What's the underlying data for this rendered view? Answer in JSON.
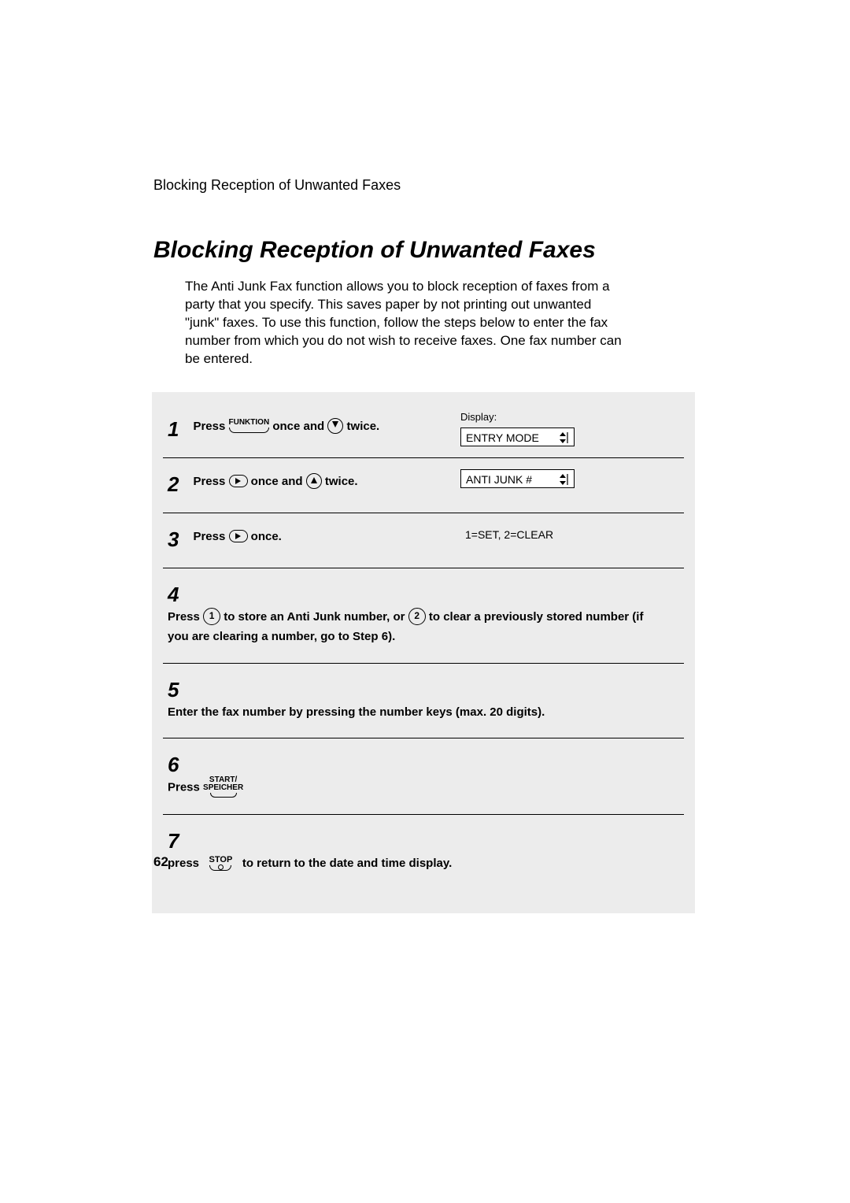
{
  "running_head": "Blocking Reception of Unwanted Faxes",
  "title": "Blocking Reception of Unwanted Faxes",
  "intro": "The Anti Junk Fax function allows you to block reception of faxes from a party that you specify. This saves paper by not printing out unwanted \"junk\" faxes. To use this function, follow the steps below to enter the fax number from which you do not wish to receive faxes. One fax number can be entered.",
  "display_label": "Display:",
  "steps": {
    "s1": {
      "num": "1",
      "t1": "Press ",
      "key1": "FUNKTION",
      "t2": " once and ",
      "t3": " twice.",
      "lcd": "ENTRY MODE"
    },
    "s2": {
      "num": "2",
      "t1": "Press ",
      "t2": " once and ",
      "t3": " twice.",
      "lcd": "ANTI JUNK #"
    },
    "s3": {
      "num": "3",
      "t1": "Press ",
      "t2": " once.",
      "lcd": "1=SET, 2=CLEAR"
    },
    "s4": {
      "num": "4",
      "t1": "Press ",
      "key1": "1",
      "t2": " to store an Anti Junk number, or ",
      "key2": "2",
      "t3": " to clear a previously stored number (if you are clearing a number, go to Step 6)."
    },
    "s5": {
      "num": "5",
      "t1": "Enter the fax number by pressing the number keys (max. 20 digits)."
    },
    "s6": {
      "num": "6",
      "t1": "Press ",
      "key_top": "START/",
      "key_bot": "SPEICHER"
    },
    "s7": {
      "num": "7",
      "t1": "press ",
      "key": "STOP",
      "t2": " to return to the date and time display."
    }
  },
  "page_number": "62"
}
